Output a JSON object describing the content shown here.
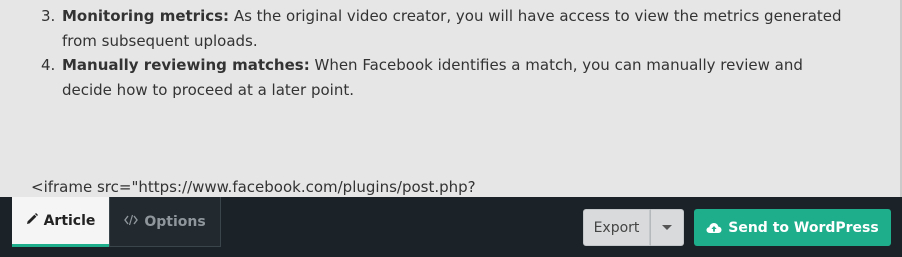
{
  "content": {
    "steps": [
      {
        "number": "3.",
        "title": "Monitoring metrics:",
        "text": " As the original video creator, you will have access to view the metrics generated from subsequent uploads."
      },
      {
        "number": "4.",
        "title": "Manually reviewing matches:",
        "text": " When Facebook identifies a match, you can manually review and decide how to proceed at a later point."
      }
    ],
    "code_line": "<iframe src=\"https://www.facebook.com/plugins/post.php?"
  },
  "toolbar": {
    "tabs": [
      {
        "label": "Article",
        "icon": "pencil-icon",
        "active": true
      },
      {
        "label": "Options",
        "icon": "code-icon",
        "active": false
      }
    ],
    "export_label": "Export",
    "send_label": "Send to WordPress",
    "send_icon": "cloud-upload-icon"
  },
  "colors": {
    "accent": "#1fae8c",
    "toolbar_bg": "#1b2328",
    "content_bg": "#e6e6e6"
  }
}
